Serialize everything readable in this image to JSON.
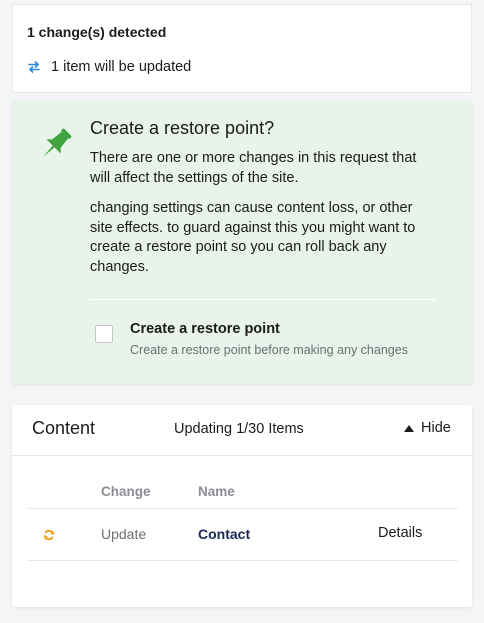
{
  "summary": {
    "title": "1 change(s) detected",
    "items_text": "1 item will be updated",
    "icon": "swap-arrows-icon",
    "icon_color": "#2b88d8"
  },
  "restore": {
    "title": "Create a restore point?",
    "text1": "There are one or more changes in this request that will affect the settings of the site.",
    "text2": "changing settings can cause content loss, or other site effects. to guard against this you might want to create a restore point so you can roll back any changes.",
    "checkbox_label": "Create a restore point",
    "checkbox_desc": "Create a restore point before making any changes",
    "checkbox_checked": false,
    "icon": "pushpin-icon",
    "icon_color": "#3fa33f",
    "background": "#e8f3e9"
  },
  "content": {
    "title": "Content",
    "status": "Updating 1/30 Items",
    "toggle_label": "Hide",
    "columns": {
      "change": "Change",
      "name": "Name"
    },
    "rows": [
      {
        "change": "Update",
        "name": "Contact",
        "action": "Details",
        "icon": "sync-icon",
        "icon_color": "#f0a020"
      }
    ]
  }
}
